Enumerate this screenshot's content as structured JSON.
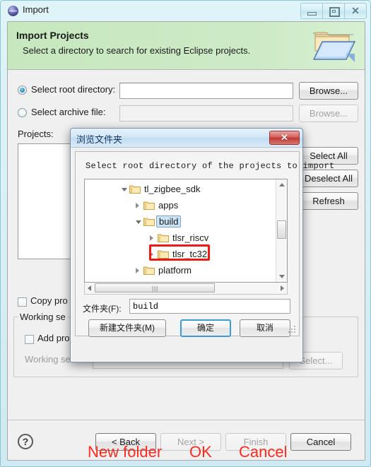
{
  "window": {
    "title": "Import",
    "icon": "eclipse-globe-icon",
    "controls": {
      "minimize": "minimize-icon",
      "maximize": "maximize-icon",
      "close": "✕"
    }
  },
  "banner": {
    "title": "Import Projects",
    "subtitle": "Select a directory to search for existing Eclipse projects.",
    "icon": "open-folder-icon",
    "background": "#c8e8c0"
  },
  "form": {
    "root_directory": {
      "label": "Select root directory:",
      "selected": true,
      "value": "",
      "browse_label": "Browse..."
    },
    "archive_file": {
      "label": "Select archive file:",
      "selected": false,
      "value": "",
      "browse_label": "Browse...",
      "disabled": true
    },
    "projects_label": "Projects:",
    "side_buttons": [
      {
        "label": "Select All"
      },
      {
        "label": "Deselect All"
      },
      {
        "label": "Refresh"
      }
    ],
    "copy_projects": {
      "label": "Copy pro",
      "checked": false
    },
    "working_sets_group": "Working se",
    "add_project": {
      "label": "Add pro",
      "checked": false
    },
    "working_sets_field": {
      "label": "Working sets:",
      "value": "",
      "select_label": "Select...",
      "disabled": true
    }
  },
  "footer": {
    "help": "?",
    "buttons": [
      {
        "label": "< Back",
        "disabled": false
      },
      {
        "label": "Next >",
        "disabled": true
      },
      {
        "label": "Finish",
        "disabled": true
      },
      {
        "label": "Cancel",
        "disabled": false
      }
    ]
  },
  "dialog": {
    "title": "浏览文件夹",
    "close": "✕",
    "instruction": "Select root directory of the projects to import",
    "tree": [
      {
        "label": "tl_zigbee_sdk",
        "indent": 0,
        "expanded": true,
        "selected": false,
        "highlight": false
      },
      {
        "label": "apps",
        "indent": 1,
        "expanded": false,
        "selected": false,
        "highlight": false
      },
      {
        "label": "build",
        "indent": 1,
        "expanded": true,
        "selected": true,
        "highlight": false
      },
      {
        "label": "tlsr_riscv",
        "indent": 2,
        "expanded": false,
        "selected": false,
        "highlight": false
      },
      {
        "label": "tlsr_tc32",
        "indent": 2,
        "expanded": false,
        "selected": false,
        "highlight": true
      },
      {
        "label": "platform",
        "indent": 1,
        "expanded": false,
        "selected": false,
        "highlight": false
      }
    ],
    "folder_field": {
      "label": "文件夹(F):",
      "value": "build"
    },
    "buttons": {
      "new_folder": "新建文件夹(M)",
      "ok": "确定",
      "cancel": "取消"
    },
    "annotations": {
      "new_folder": "New folder",
      "ok": "OK",
      "cancel": "Cancel",
      "color": "#ff2a20"
    }
  }
}
